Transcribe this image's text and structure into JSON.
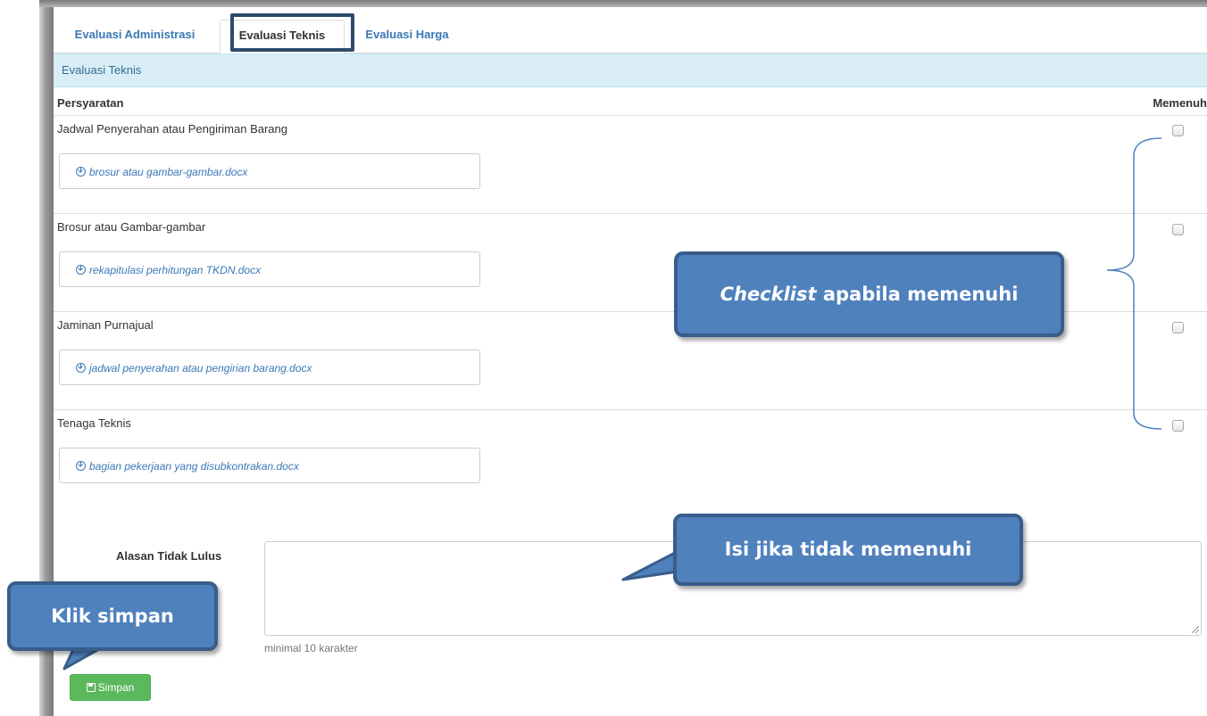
{
  "tabs": [
    {
      "label": "Evaluasi Administrasi"
    },
    {
      "label": "Evaluasi Teknis"
    },
    {
      "label": "Evaluasi Harga"
    }
  ],
  "section": {
    "title": "Evaluasi Teknis"
  },
  "table": {
    "col_requirement": "Persyaratan",
    "col_meets": "Memenuh",
    "rows": [
      {
        "label": "Jadwal Penyerahan atau Pengiriman Barang",
        "file": "brosur atau gambar-gambar.docx",
        "checked": false
      },
      {
        "label": "Brosur atau Gambar-gambar",
        "file": "rekapitulasi perhitungan TKDN.docx",
        "checked": false
      },
      {
        "label": "Jaminan Purnajual",
        "file": "jadwal penyerahan atau pengirian barang.docx",
        "checked": false
      },
      {
        "label": "Tenaga Teknis",
        "file": "bagian pekerjaan yang disubkontrakan.docx",
        "checked": false
      }
    ]
  },
  "reason": {
    "label": "Alasan Tidak Lulus",
    "value": "",
    "hint": "minimal 10 karakter"
  },
  "save_button": {
    "label": "Simpan",
    "icon": "floppy-disk-icon",
    "color": "#5cb85c"
  },
  "annotations": {
    "checklist_italic": "Checklist",
    "checklist_rest": " apabila memenuhi",
    "fill_reason": "Isi jika tidak memenuhi",
    "click_save": "Klik simpan",
    "color": "#4f81bd"
  }
}
